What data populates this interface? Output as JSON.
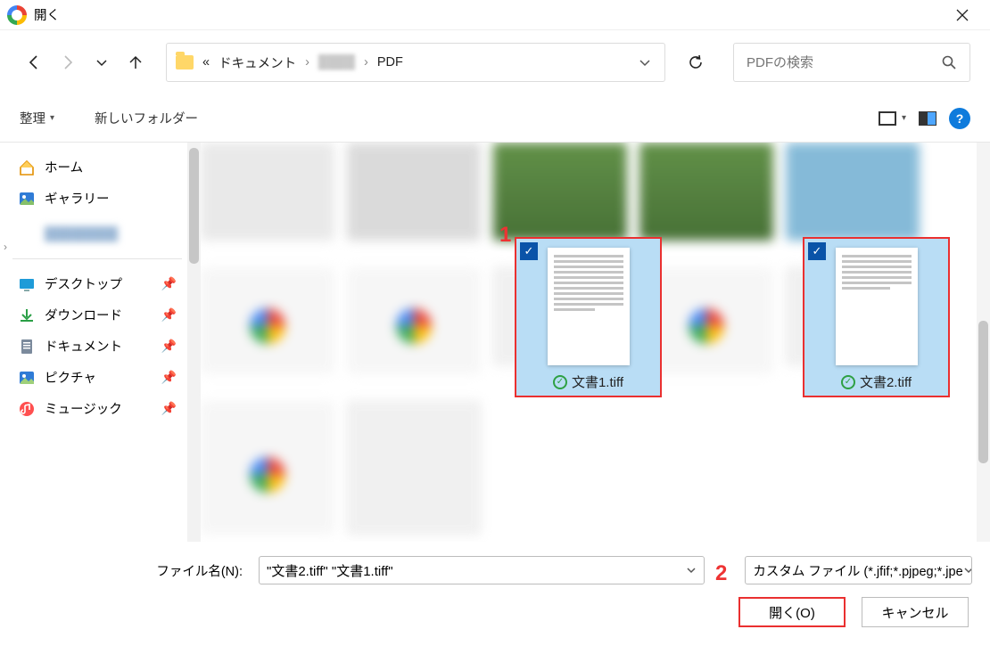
{
  "title": "開く",
  "nav": {
    "back": true,
    "forward": false,
    "recent": true,
    "up": true
  },
  "breadcrumb": {
    "root_marker": "«",
    "items": [
      "ドキュメント",
      "",
      "PDF"
    ]
  },
  "search": {
    "placeholder": "PDFの検索"
  },
  "toolbar": {
    "organize": "整理",
    "newfolder": "新しいフォルダー"
  },
  "sidebar": {
    "home": "ホーム",
    "gallery": "ギャラリー",
    "quick": [
      {
        "label": "デスクトップ"
      },
      {
        "label": "ダウンロード"
      },
      {
        "label": "ドキュメント"
      },
      {
        "label": "ピクチャ"
      },
      {
        "label": "ミュージック"
      }
    ]
  },
  "files": {
    "selected": [
      {
        "name": "文書1.tiff"
      },
      {
        "name": "文書2.tiff"
      }
    ]
  },
  "annotations": {
    "one": "1",
    "two": "2"
  },
  "bottom": {
    "filename_label": "ファイル名(N):",
    "filename_value": "\"文書2.tiff\" \"文書1.tiff\"",
    "filetype": "カスタム ファイル (*.jfif;*.pjpeg;*.jpe",
    "open": "開く(O)",
    "cancel": "キャンセル"
  }
}
